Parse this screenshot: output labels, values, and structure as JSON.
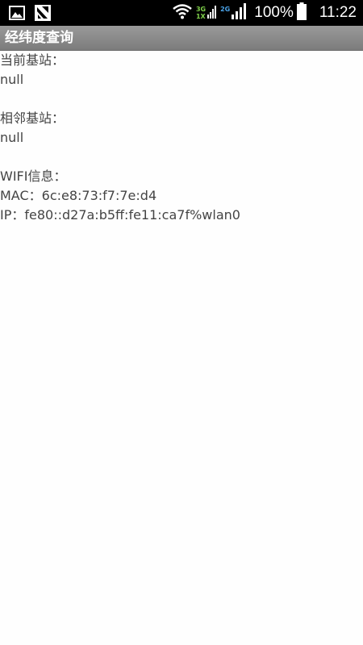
{
  "status_bar": {
    "network_3g": "3G",
    "network_1x": "1X",
    "network_2g": "2G",
    "battery_percent": "100%",
    "time": "11:22",
    "icons": [
      "gallery-icon",
      "app-notification-icon",
      "wifi-icon",
      "signal-icon",
      "battery-icon"
    ]
  },
  "app_bar": {
    "title": "经纬度查询"
  },
  "main": {
    "current_station_label": "当前基站：",
    "current_station_value": "null",
    "neighbor_station_label": "相邻基站：",
    "neighbor_station_value": "null",
    "wifi_label": "WIFI信息：",
    "mac_line": "MAC：6c:e8:73:f7:7e:d4",
    "ip_line": "IP：fe80::d27a:b5ff:fe11:ca7f%wlan0"
  }
}
